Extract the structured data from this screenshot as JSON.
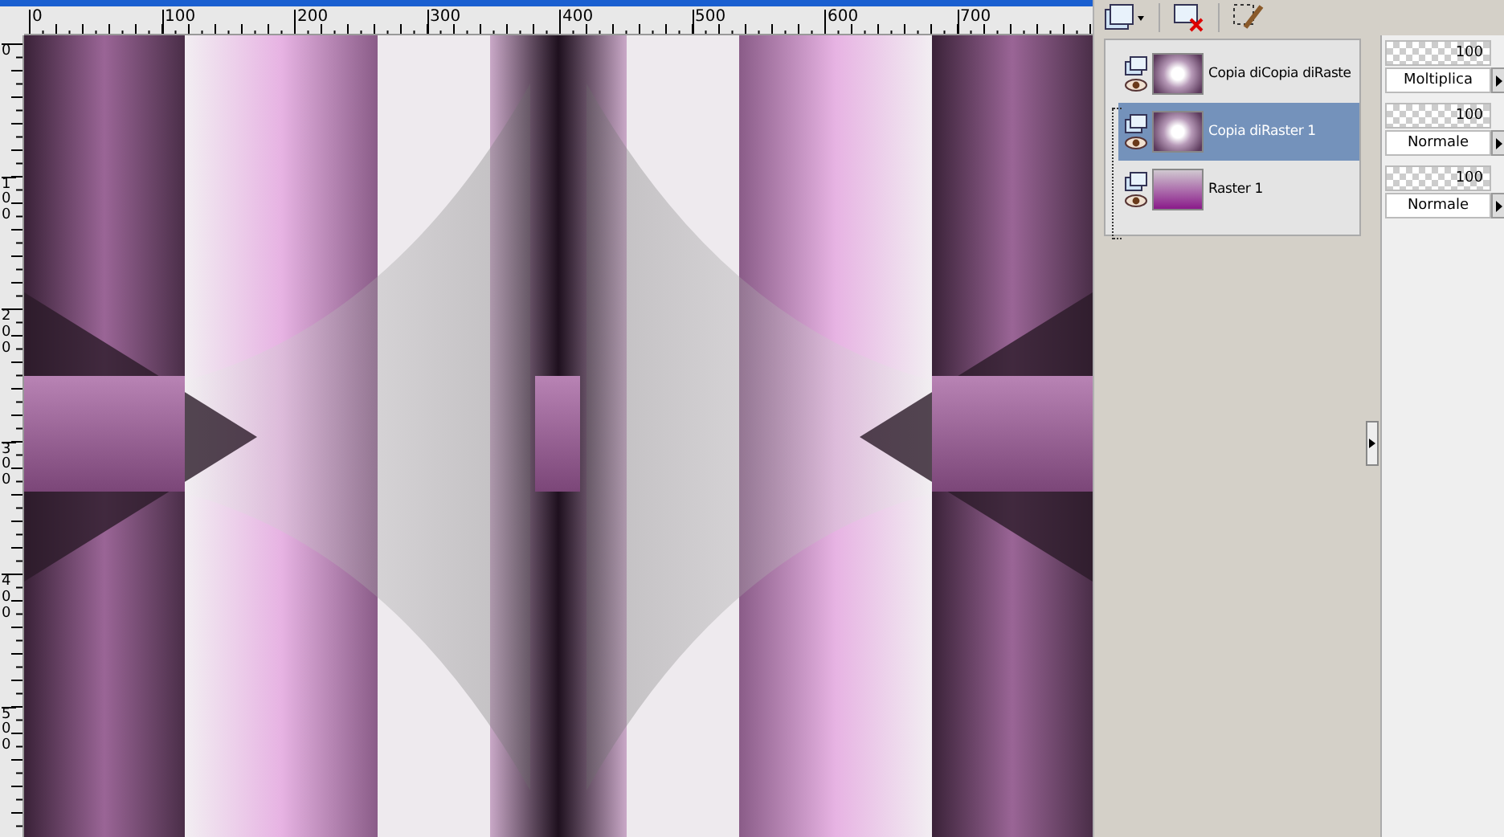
{
  "ruler_top": {
    "labels": [
      "0",
      "100",
      "200",
      "300",
      "400",
      "500",
      "600",
      "700"
    ]
  },
  "ruler_left": {
    "labels": [
      "0",
      "100",
      "200",
      "300",
      "400",
      "500"
    ]
  },
  "layers": [
    {
      "name": "Copia diCopia diRaste",
      "selected": false,
      "blend_mode": "Moltiplica",
      "opacity": "100",
      "kind": "pattern"
    },
    {
      "name": "Copia diRaster 1",
      "selected": true,
      "blend_mode": "Normale",
      "opacity": "100",
      "kind": "pattern"
    },
    {
      "name": "Raster 1",
      "selected": false,
      "blend_mode": "Normale",
      "opacity": "100",
      "kind": "gradient"
    }
  ]
}
